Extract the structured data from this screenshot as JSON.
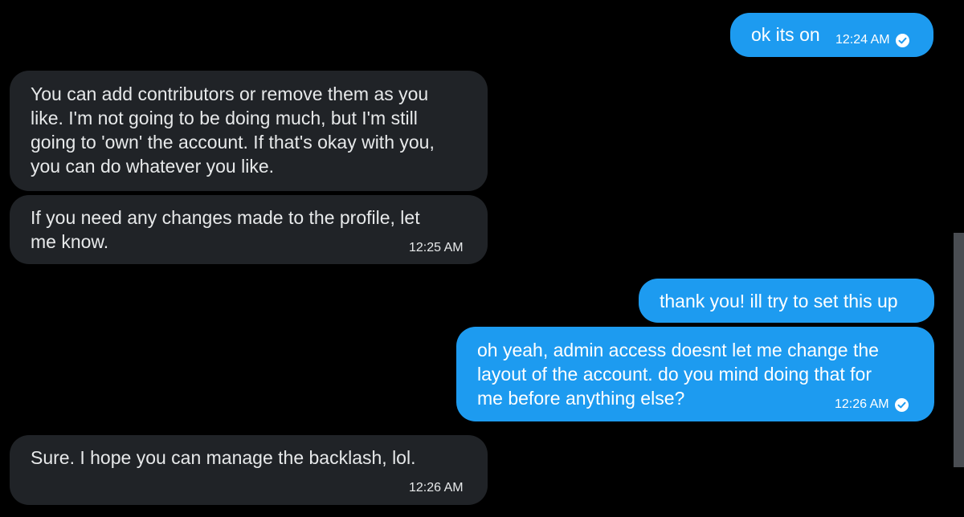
{
  "messages": [
    {
      "direction": "outgoing",
      "text": "ok its on",
      "time": "12:24 AM",
      "status_icon": "read-check-icon"
    },
    {
      "direction": "incoming",
      "text": "You can add contributors or remove them as you\nlike. I'm not going to be doing much, but I'm still\ngoing to 'own' the account. If that's okay with you,\nyou can do whatever you like."
    },
    {
      "direction": "incoming",
      "text": "If you need any changes made to the profile, let\nme know.",
      "time": "12:25 AM"
    },
    {
      "direction": "outgoing",
      "text": "thank you! ill try to set this up"
    },
    {
      "direction": "outgoing",
      "text": "oh yeah, admin access doesnt let me change the\nlayout of the account. do you mind doing that for\nme before anything else?",
      "time": "12:26 AM",
      "status_icon": "read-check-icon"
    },
    {
      "direction": "incoming",
      "text": "Sure. I hope you can manage the backlash, lol.",
      "time": "12:26 AM"
    }
  ],
  "colors": {
    "background": "#000000",
    "incoming_bubble": "#202327",
    "outgoing_bubble": "#1d9bf0",
    "text": "#e7e9ea"
  }
}
